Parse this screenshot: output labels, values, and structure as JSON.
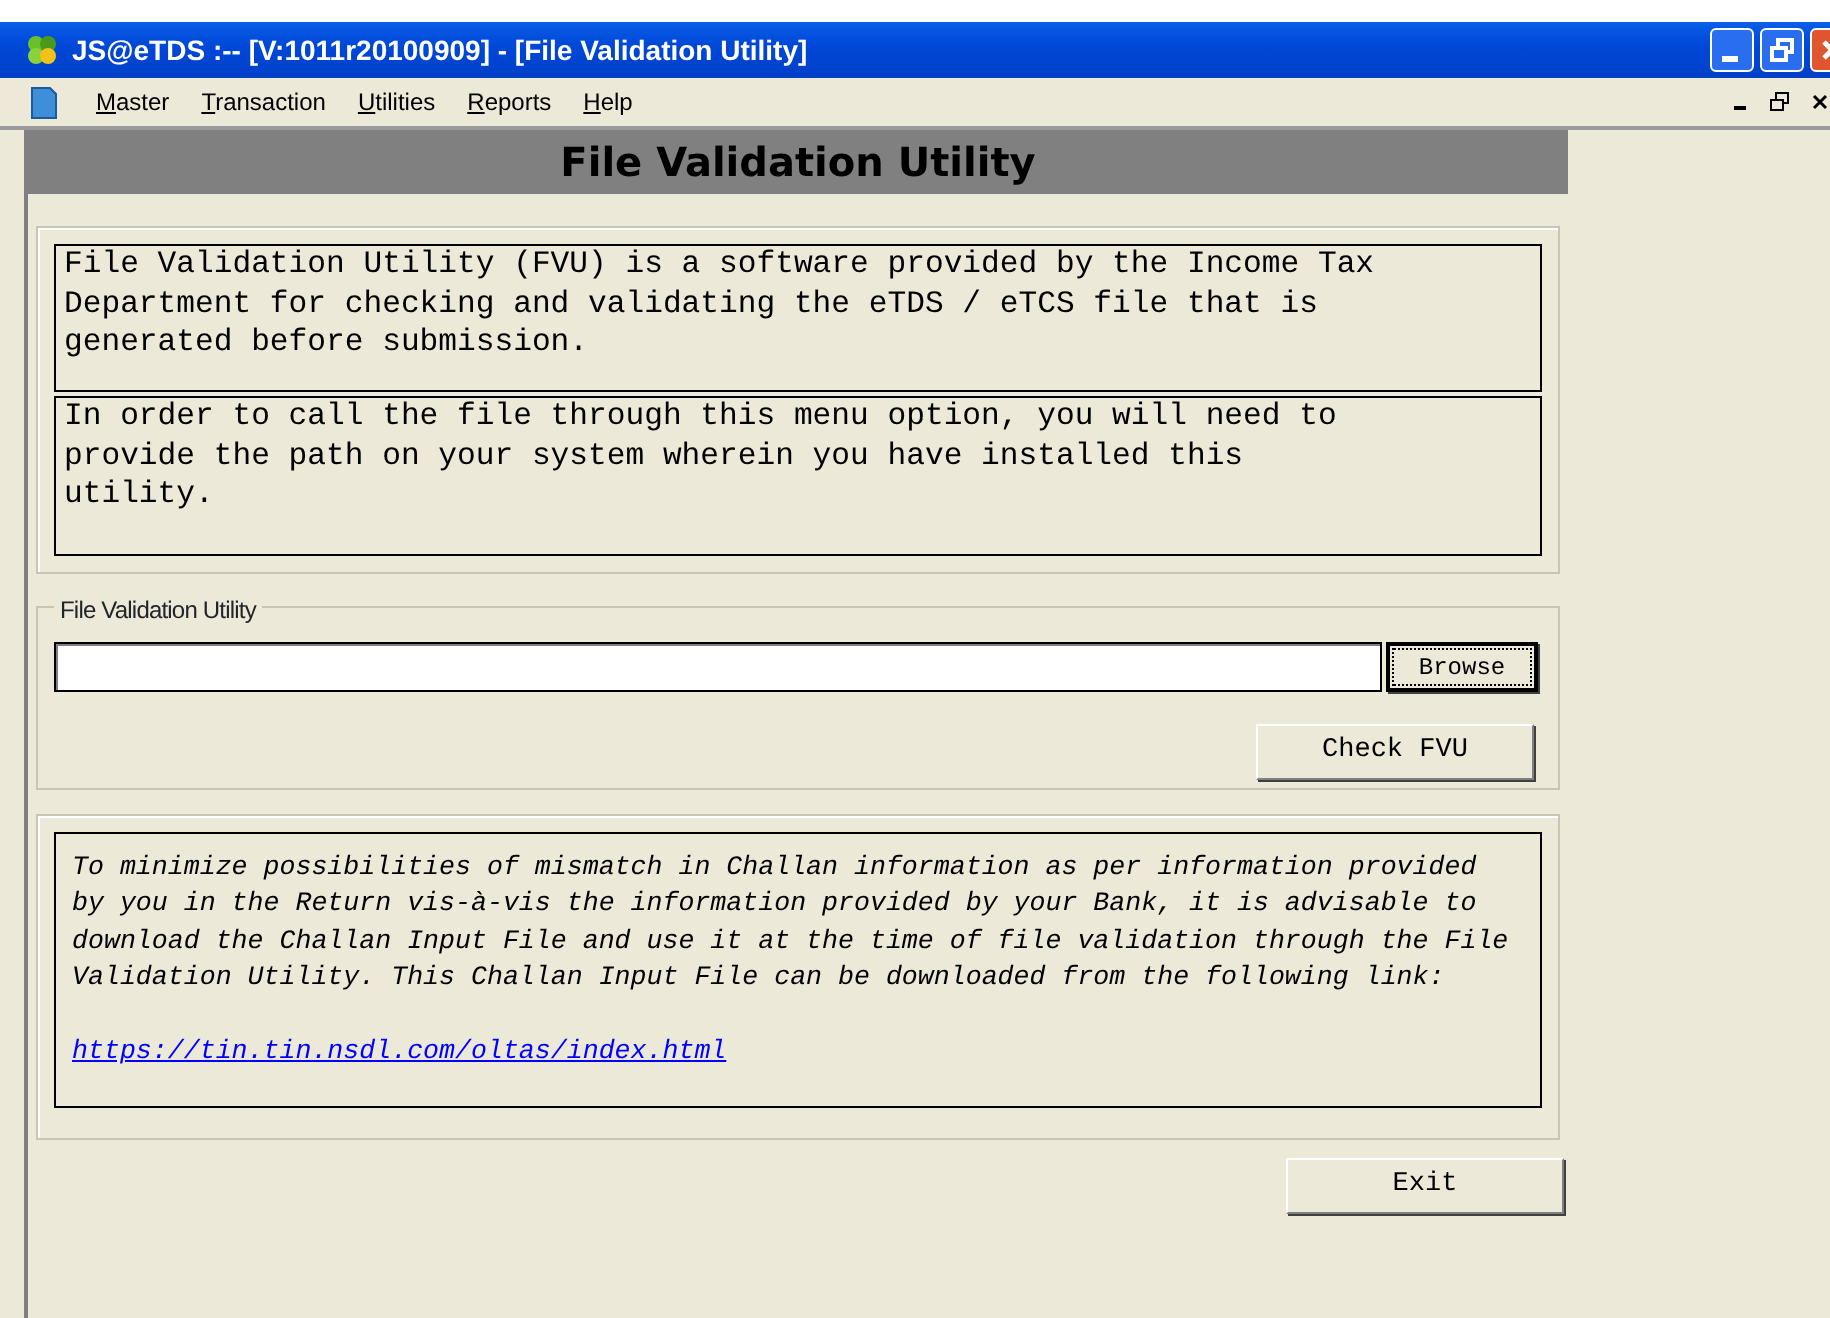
{
  "window": {
    "title": "JS@eTDS :--  [V:1011r20100909] - [File Validation Utility]"
  },
  "menu": [
    {
      "label": "Master"
    },
    {
      "label": "Transaction"
    },
    {
      "label": "Utilities"
    },
    {
      "label": "Reports"
    },
    {
      "label": "Help"
    }
  ],
  "form": {
    "heading": "File Validation Utility",
    "info_paragraphs": [
      {
        "lines": [
          "File Validation Utility (FVU) is a software provided by the Income Tax",
          "Department for checking and validating the eTDS / eTCS file that is",
          "generated before submission."
        ]
      },
      {
        "lines": [
          "In order to call the file through this menu option, you will need to",
          "provide the path on your system wherein you have installed this",
          "utility."
        ]
      }
    ],
    "fvu_group": {
      "legend": "File Validation Utility",
      "browse_button": "Browse",
      "check_button": "Check FVU"
    },
    "challan_note": {
      "lines": [
        "To minimize possibilities of mismatch in Challan information as per information provided",
        "by you in the Return vis-à-vis the information provided by your Bank, it is advisable to",
        "download the Challan Input File and use it at the time of file validation through the File",
        "Validation Utility. This Challan Input File can be downloaded from the following link:"
      ],
      "link": "https://tin.tin.nsdl.com/oltas/index.html"
    },
    "exit_button": "Exit"
  }
}
